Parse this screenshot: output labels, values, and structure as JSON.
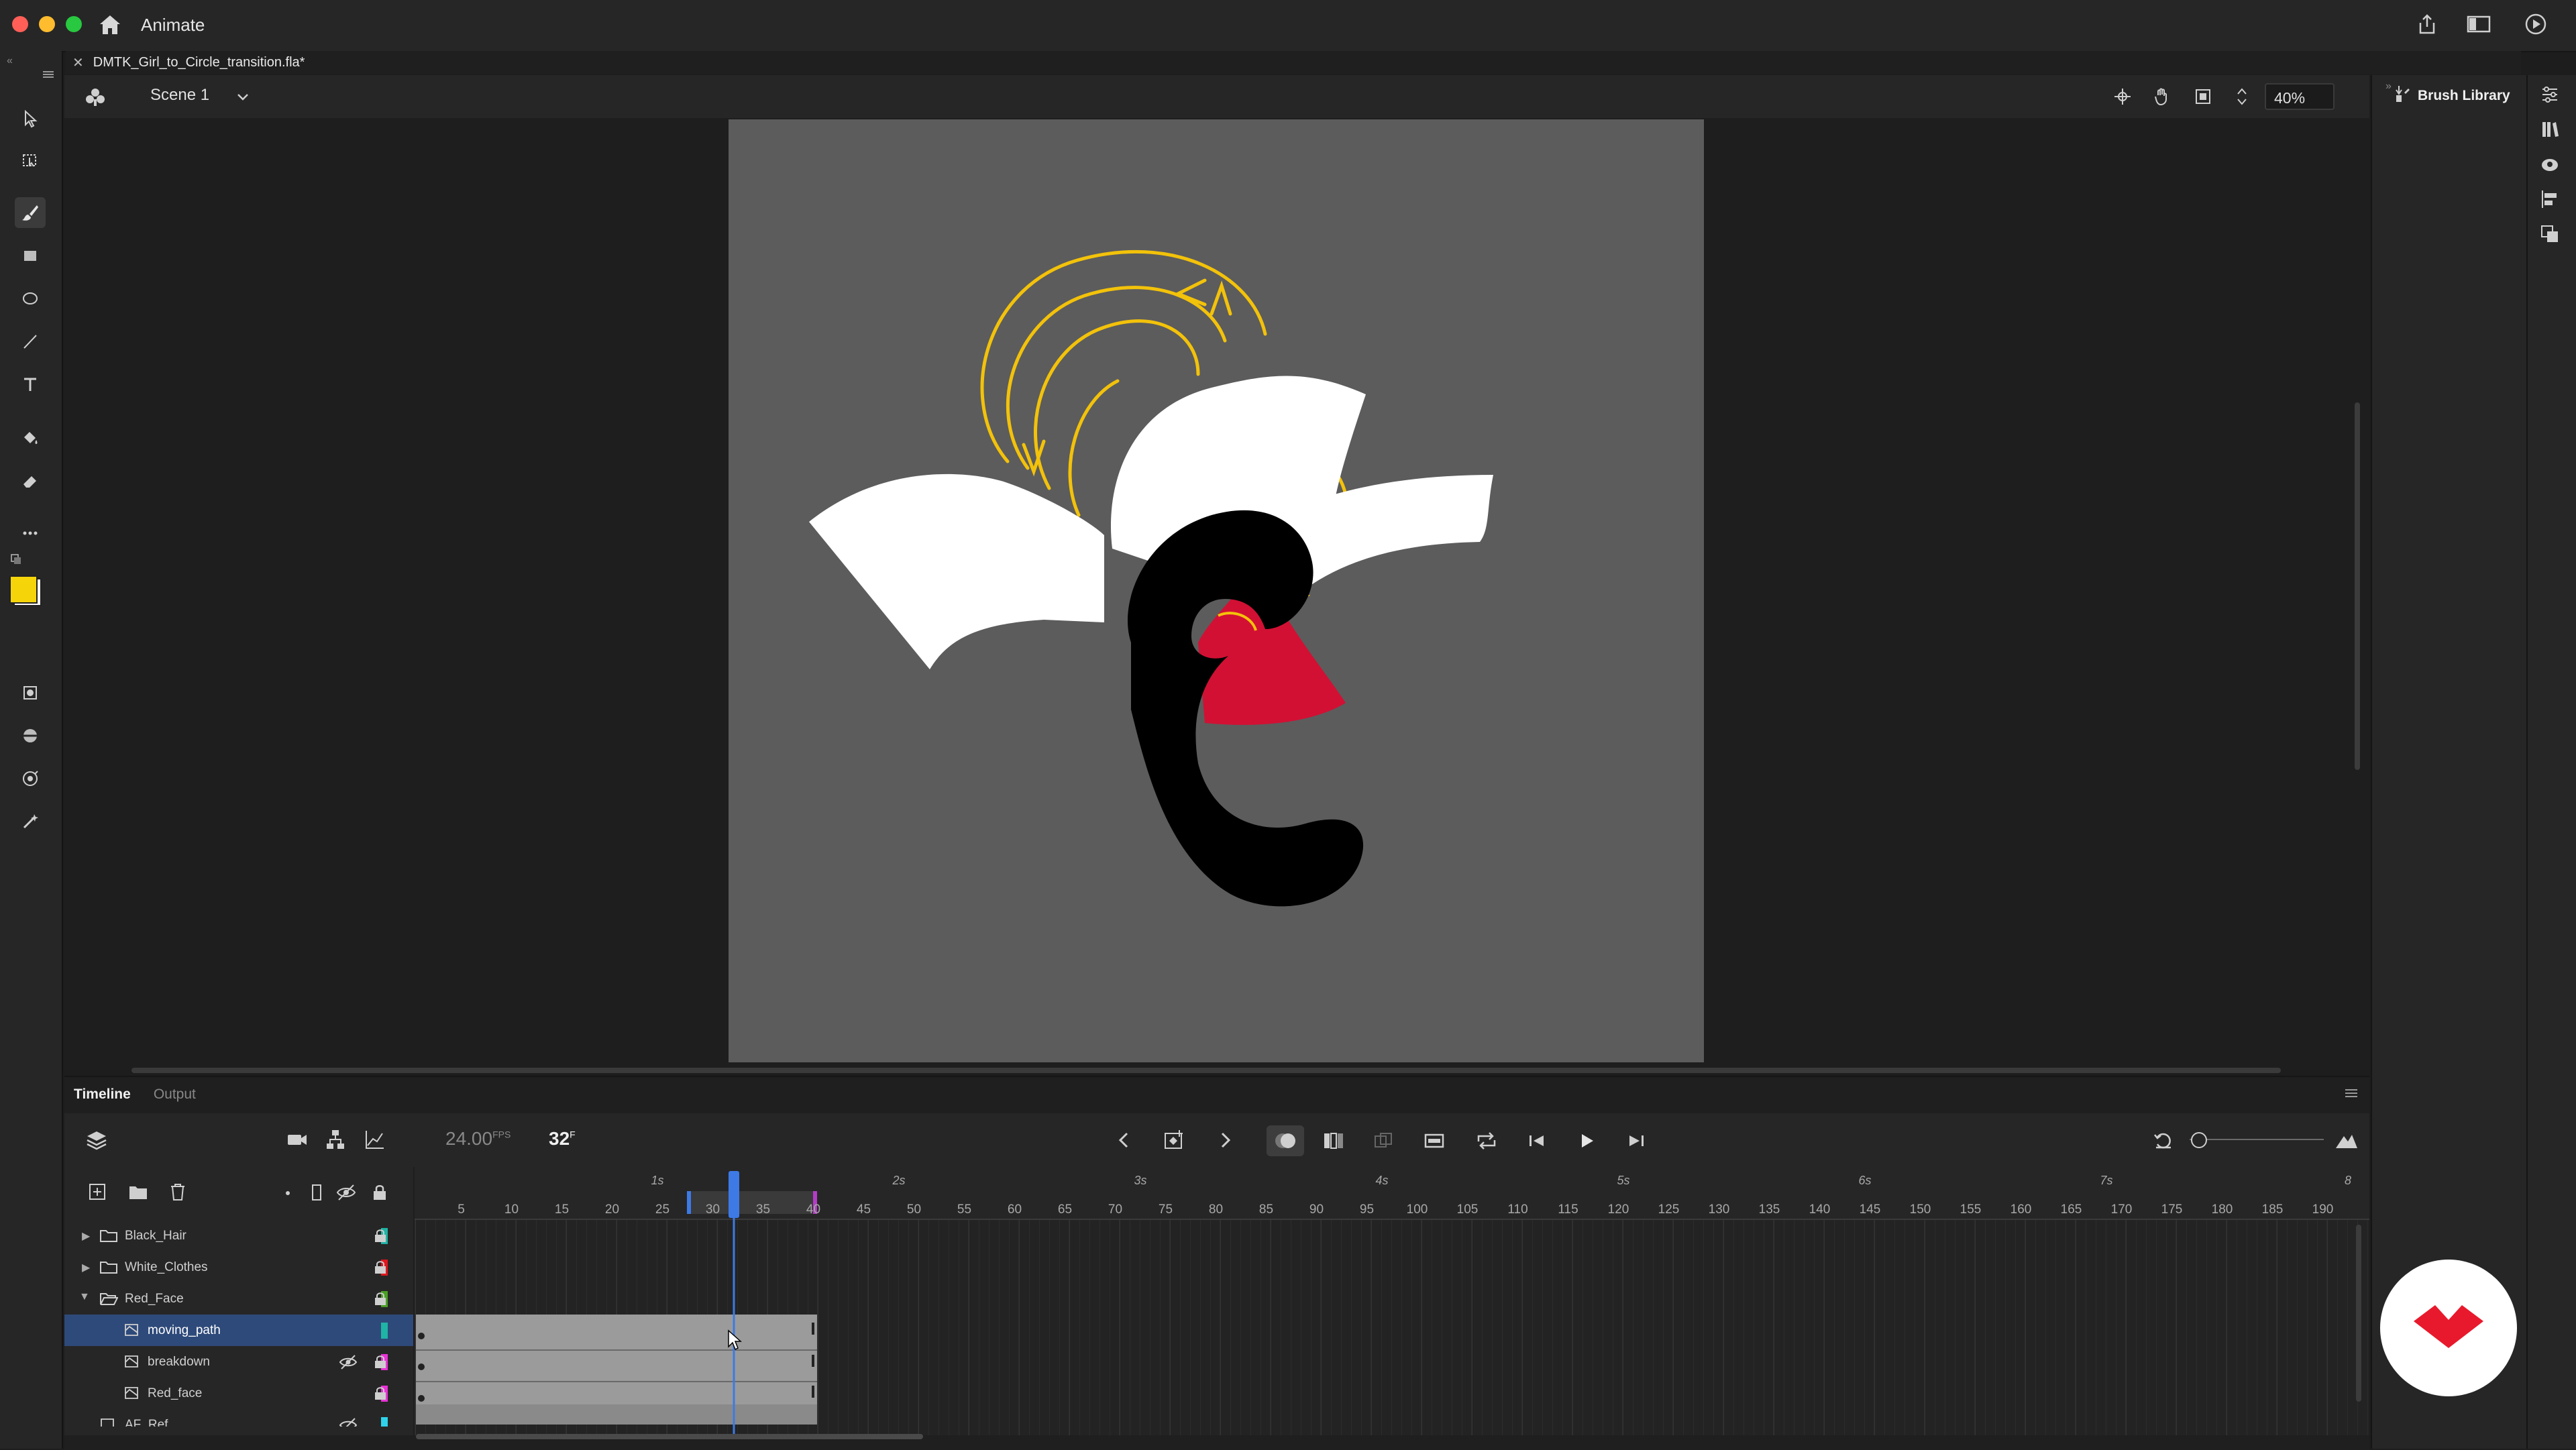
{
  "app": {
    "name": "Animate"
  },
  "document": {
    "tab_title": "DMTK_Girl_to_Circle_transition.fla*"
  },
  "editbar": {
    "scene": "Scene 1",
    "zoom": "40%"
  },
  "right_panel": {
    "brush_library": "Brush Library"
  },
  "timeline": {
    "tabs": [
      "Timeline",
      "Output"
    ],
    "fps": "24.00",
    "fps_unit": "FPS",
    "current_frame": "32",
    "frame_unit": "F",
    "ruler": [
      "5",
      "10",
      "15",
      "20",
      "25",
      "30",
      "35",
      "40",
      "45",
      "50",
      "55",
      "60",
      "65",
      "70",
      "75",
      "80",
      "85",
      "90",
      "95",
      "100",
      "105",
      "110",
      "115",
      "120",
      "125",
      "130",
      "135",
      "140",
      "145",
      "150",
      "155",
      "160",
      "165",
      "170",
      "175",
      "180",
      "185",
      "190"
    ],
    "seconds": [
      "1s",
      "2s",
      "3s",
      "4s",
      "5s",
      "6s",
      "7s",
      "8"
    ],
    "layers": [
      {
        "name": "Black_Hair",
        "type": "folder",
        "color": "#1fb4a5",
        "expanded": false
      },
      {
        "name": "White_Clothes",
        "type": "folder",
        "color": "#e0161e",
        "expanded": false
      },
      {
        "name": "Red_Face",
        "type": "folder",
        "color": "#4aa025",
        "expanded": true
      },
      {
        "name": "moving_path",
        "type": "layer",
        "color": "#1fb4a5",
        "selected": true
      },
      {
        "name": "breakdown",
        "type": "layer",
        "color": "#e932d6",
        "hidden": true
      },
      {
        "name": "Red_face",
        "type": "layer",
        "color": "#e932d6"
      },
      {
        "name": "AF_Ref",
        "type": "layer",
        "color": "#2fd2ea",
        "hidden": true
      }
    ]
  },
  "colors": {
    "accent": "#3d7ae6",
    "fill_swatch": "#f5d50a",
    "selection": "#2e4a7a",
    "stage": "#5c5c5c"
  }
}
